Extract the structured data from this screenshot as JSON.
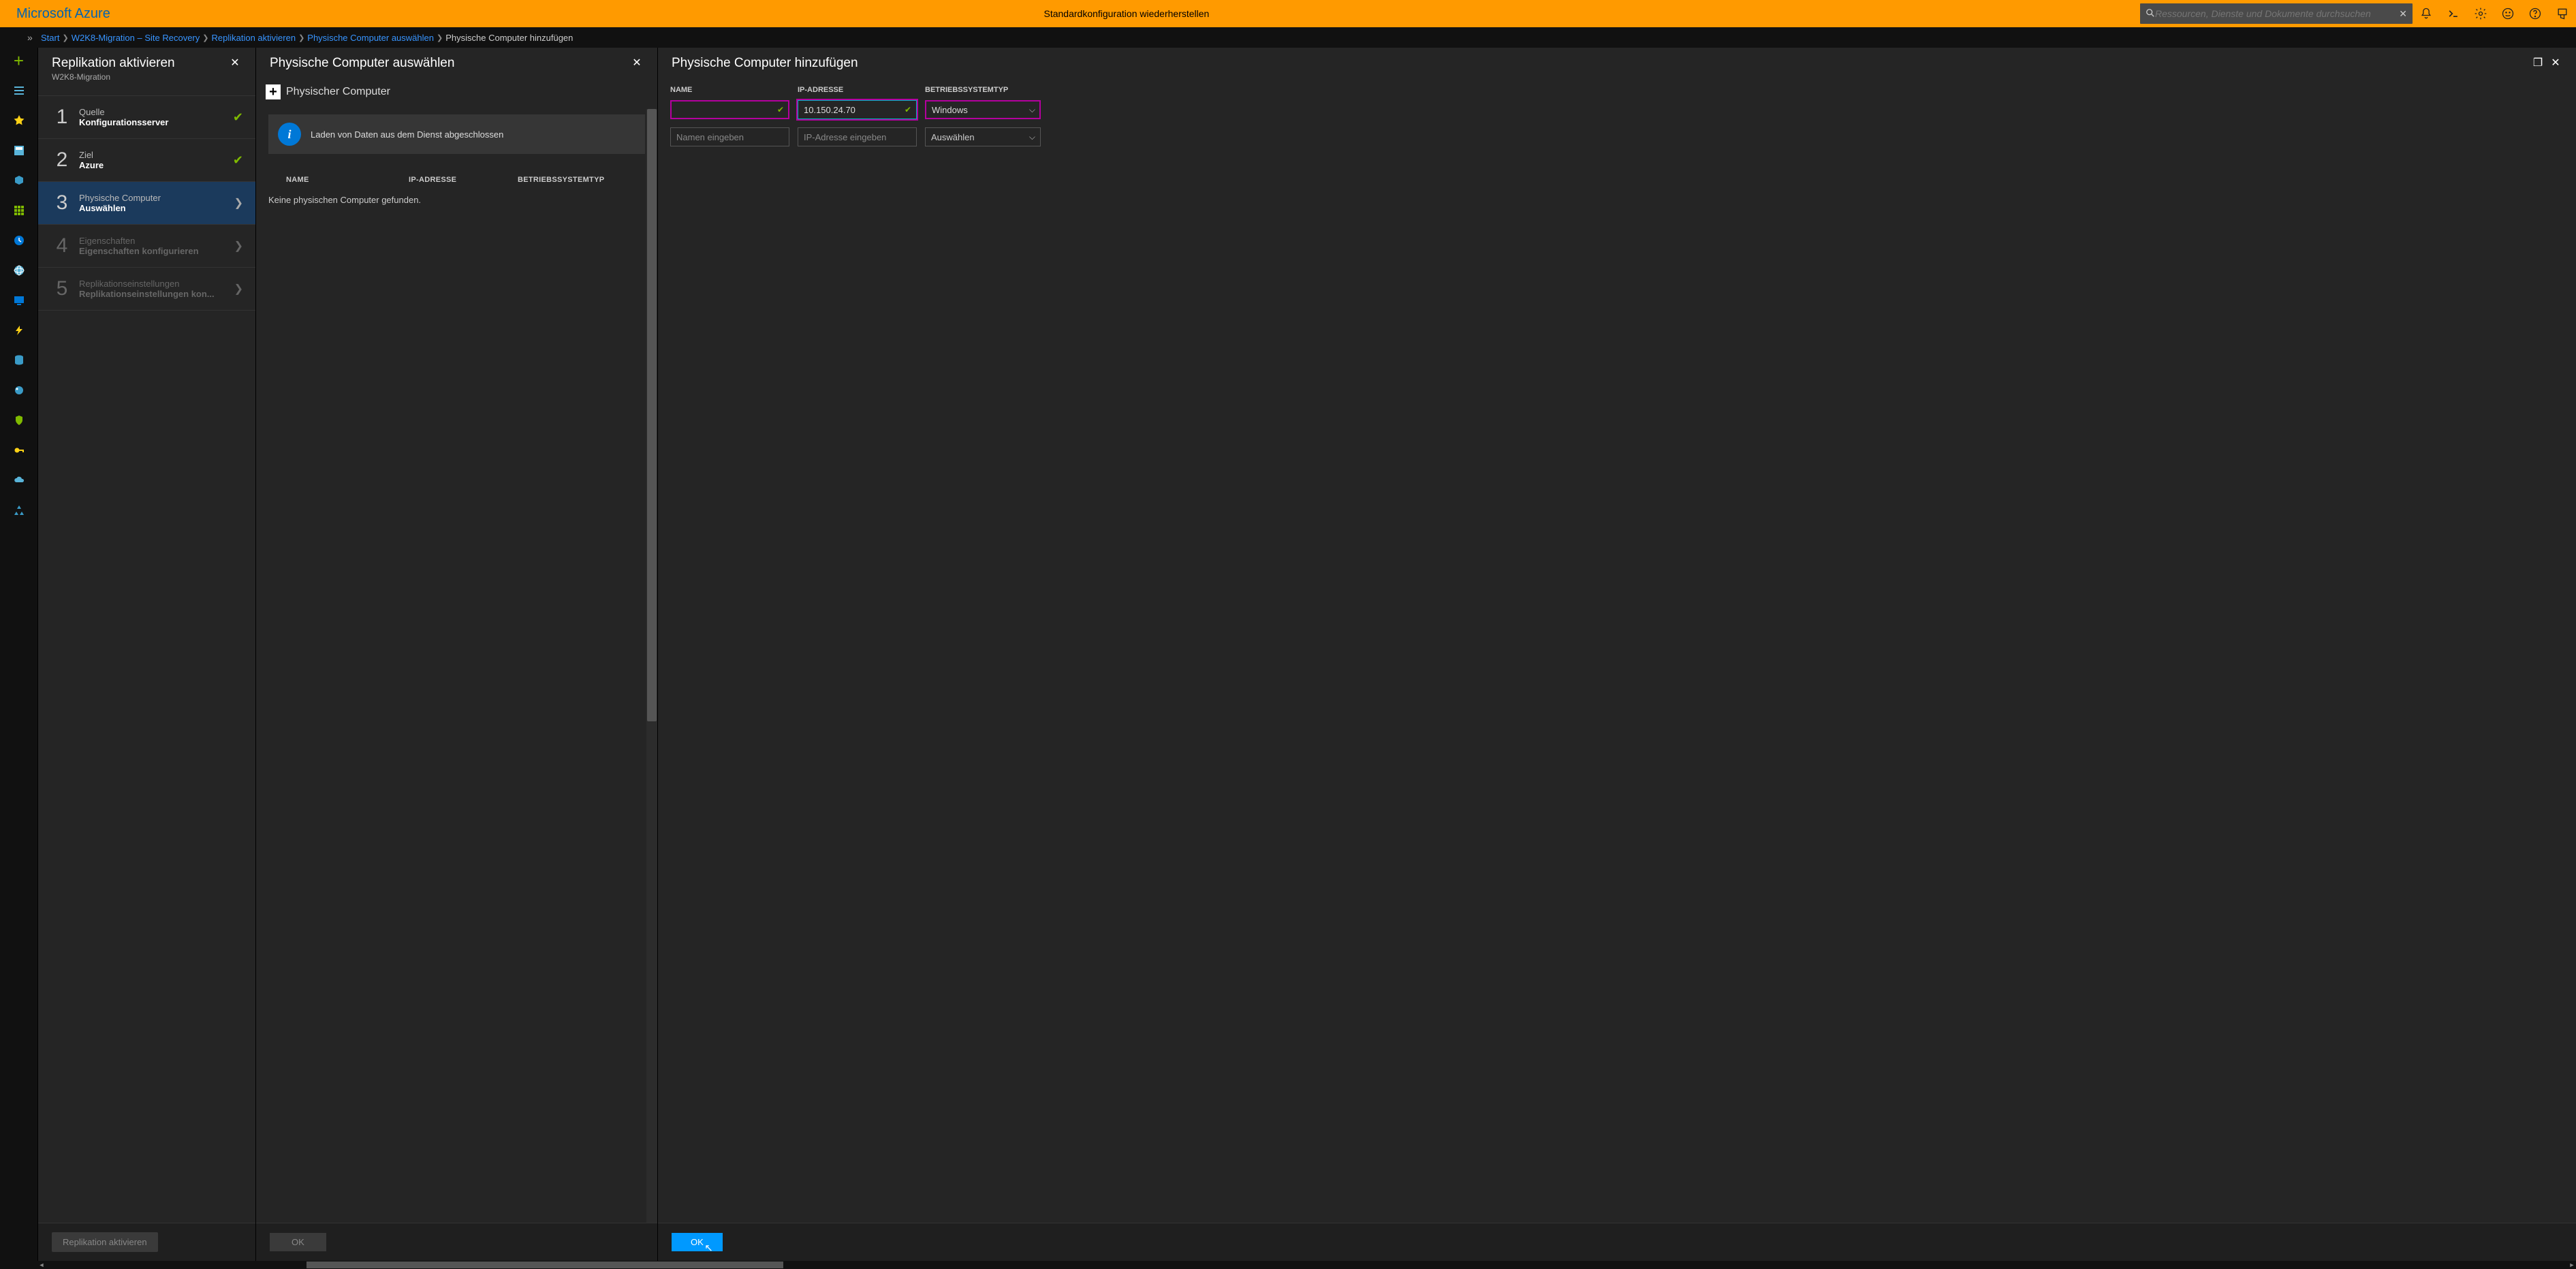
{
  "topbar": {
    "brand": "Microsoft Azure",
    "restore_link": "Standardkonfiguration wiederherstellen",
    "search_placeholder": "Ressourcen, Dienste und Dokumente durchsuchen"
  },
  "breadcrumb": {
    "items": [
      "Start",
      "W2K8-Migration – Site Recovery",
      "Replikation aktivieren",
      "Physische Computer auswählen"
    ],
    "current": "Physische Computer hinzufügen"
  },
  "blade1": {
    "title": "Replikation aktivieren",
    "subtitle": "W2K8-Migration",
    "steps": [
      {
        "num": "1",
        "label": "Quelle",
        "value": "Konfigurationsserver",
        "state": "done"
      },
      {
        "num": "2",
        "label": "Ziel",
        "value": "Azure",
        "state": "done"
      },
      {
        "num": "3",
        "label": "Physische Computer",
        "value": "Auswählen",
        "state": "active"
      },
      {
        "num": "4",
        "label": "Eigenschaften",
        "value": "Eigenschaften konfigurieren",
        "state": "disabled"
      },
      {
        "num": "5",
        "label": "Replikationseinstellungen",
        "value": "Replikationseinstellungen kon...",
        "state": "disabled"
      }
    ],
    "footer_button": "Replikation aktivieren"
  },
  "blade2": {
    "title": "Physische Computer auswählen",
    "add_button": "Physischer Computer",
    "info_message": "Laden von Daten aus dem Dienst abgeschlossen",
    "columns": {
      "name": "NAME",
      "ip": "IP-ADRESSE",
      "os": "BETRIEBSSYSTEMTYP"
    },
    "empty_text": "Keine physischen Computer gefunden.",
    "ok_label": "OK"
  },
  "blade3": {
    "title": "Physische Computer hinzufügen",
    "columns": {
      "name": "NAME",
      "ip": "IP-ADRESSE",
      "os": "BETRIEBSSYSTEMTYP"
    },
    "rows": [
      {
        "name": "",
        "ip": "10.150.24.70",
        "os": "Windows",
        "state": "editing"
      }
    ],
    "placeholders": {
      "name": "Namen eingeben",
      "ip": "IP-Adresse eingeben",
      "os": "Auswählen"
    },
    "ok_label": "OK"
  }
}
